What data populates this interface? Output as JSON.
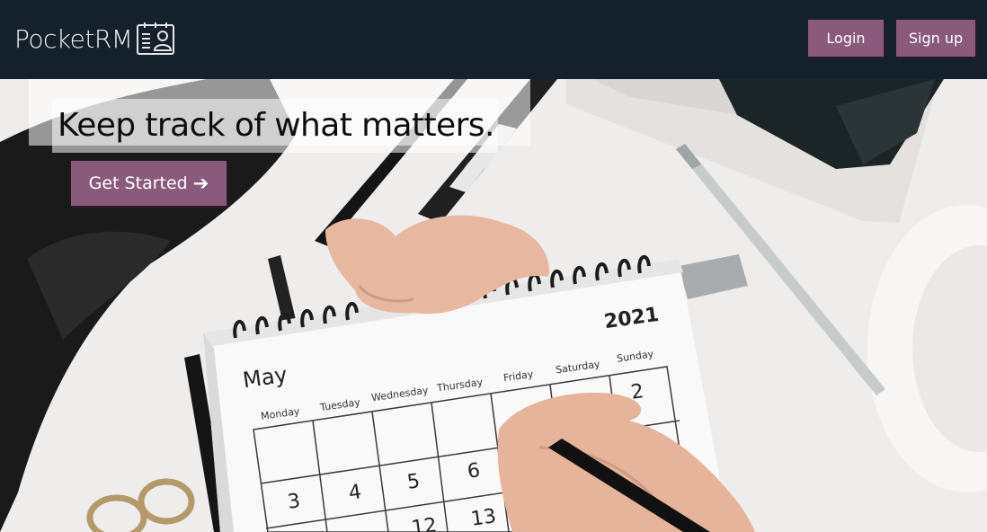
{
  "navbar": {
    "brand": "PocketRM",
    "logo_icon": "contact-card-icon",
    "login_label": "Login",
    "signup_label": "Sign up",
    "background": "#14202b",
    "button_color": "#8a5a7c"
  },
  "hero": {
    "headline": "Keep track of what matters.",
    "cta_label": "Get Started",
    "cta_icon": "arrow-right-icon",
    "image": "hand-writing-on-calendar-photo",
    "calendar": {
      "month": "May",
      "year": "2021",
      "weekdays": [
        "Monday",
        "Tuesday",
        "Wednesday",
        "Thursday",
        "Friday",
        "Saturday",
        "Sunday"
      ],
      "visible_dates": [
        "2",
        "3",
        "4",
        "5",
        "6",
        "12",
        "13"
      ]
    }
  }
}
